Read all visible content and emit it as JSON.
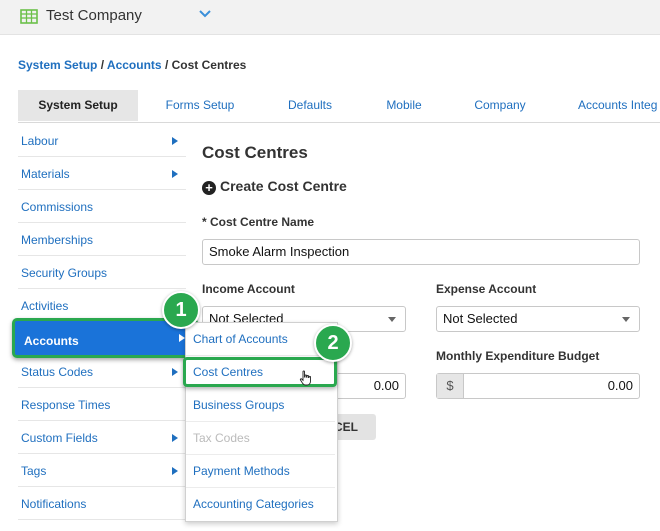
{
  "topbar": {
    "company_name": "Test Company"
  },
  "breadcrumb": {
    "item1": "System Setup",
    "sep1": " / ",
    "item2": "Accounts",
    "sep2": " / ",
    "current": "Cost Centres"
  },
  "tabs": [
    "System Setup",
    "Forms Setup",
    "Defaults",
    "Mobile",
    "Company",
    "Accounts Integ"
  ],
  "sidebar": [
    "Labour",
    "Materials",
    "Commissions",
    "Memberships",
    "Security Groups",
    "Activities",
    "Accounts",
    "Status Codes",
    "Response Times",
    "Custom Fields",
    "Tags",
    "Notifications"
  ],
  "main": {
    "title": "Cost Centres",
    "create_label": "Create Cost Centre",
    "name_label": "* Cost Centre Name",
    "name_value": "Smoke Alarm Inspection",
    "income_label": "Income Account",
    "income_value": "Not Selected",
    "expense_label": "Expense Account",
    "expense_value": "Not Selected",
    "monthly_exp_label": "Monthly Expenditure Budget",
    "income_budget_value": "0.00",
    "currency": "$",
    "expenditure_value": "0.00",
    "cancel_partial": "CEL"
  },
  "dropdown": [
    "Chart of Accounts",
    "Cost Centres",
    "Business Groups",
    "Tax Codes",
    "Payment Methods",
    "Accounting Categories"
  ],
  "badges": {
    "one": "1",
    "two": "2"
  },
  "colors": {
    "accent": "#1a73d9",
    "highlight": "#2aa84f",
    "link": "#1f6fbf"
  }
}
